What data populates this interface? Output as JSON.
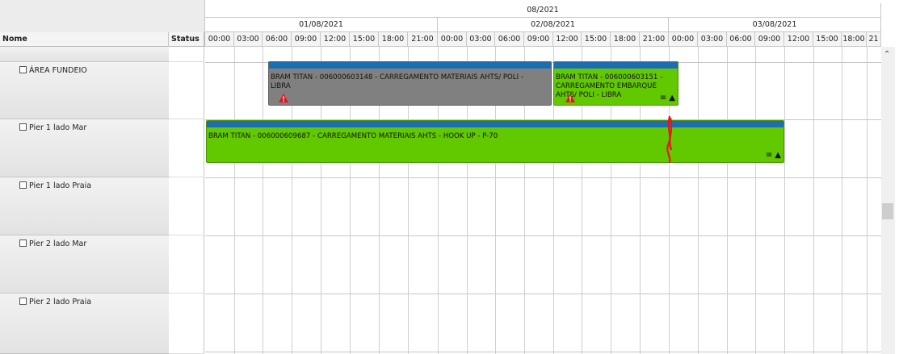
{
  "month_label": "08/2021",
  "day_labels": [
    "01/08/2021",
    "02/08/2021",
    "03/08/2021"
  ],
  "hour_labels": [
    "00:00",
    "03:00",
    "06:00",
    "09:00",
    "12:00",
    "15:00",
    "18:00",
    "21:00",
    "00:00",
    "03:00",
    "06:00",
    "09:00",
    "12:00",
    "15:00",
    "18:00",
    "21:00",
    "00:00",
    "03:00",
    "06:00",
    "09:00",
    "12:00",
    "15:00",
    "18:00",
    "21"
  ],
  "columns": {
    "name": "Nome",
    "status": "Status"
  },
  "rows": [
    {
      "label": "ÁREA FUNDEIO"
    },
    {
      "label": "Pier 1 lado Mar"
    },
    {
      "label": "Pier 1 lado Praia"
    },
    {
      "label": "Pier 2 lado Mar"
    },
    {
      "label": "Pier 2 lado Praia"
    }
  ],
  "tasks": [
    {
      "label": "BRAM TITAN - 006000603148 - CARREGAMENTO MATERIAIS AHTS/ POLI - LIBRA",
      "color": "#808080",
      "warning": true,
      "icons": false
    },
    {
      "label": "BRAM TITAN - 006000603151 - CARREGAMENTO EMBARQUE AHTS/ POLI - LIBRA",
      "color": "#62c800",
      "warning": true,
      "icons": true
    },
    {
      "label": "BRAM TITAN - 006000609687 - CARREGAMENTO MATERIAIS AHTS - HOOK UP - P-70",
      "color": "#62c800",
      "warning": false,
      "icons": true
    }
  ],
  "icon_names": [
    "checkbox-icon",
    "warning-icon",
    "menu-lines-icon",
    "pin-icon",
    "scroll-up-arrow-icon"
  ],
  "colors": {
    "task_bar": "#1d6db1",
    "marker": "#e8141b"
  }
}
